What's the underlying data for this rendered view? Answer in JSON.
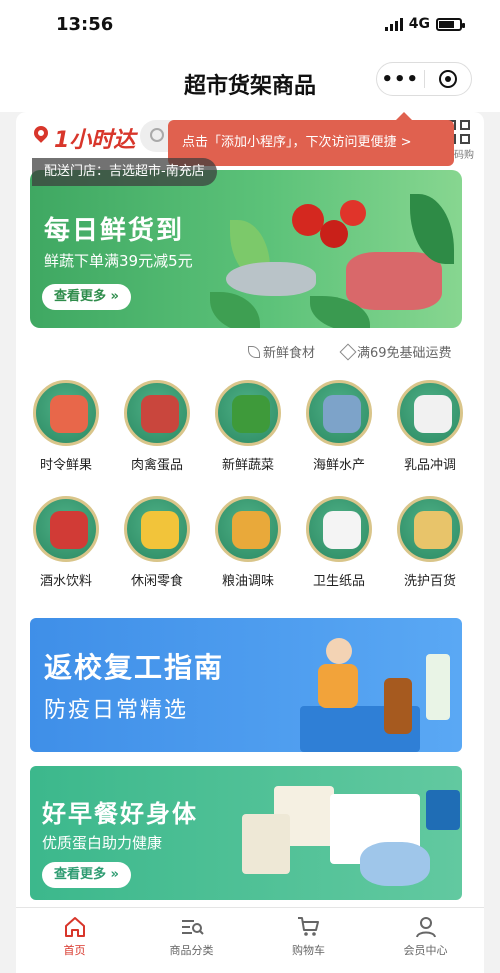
{
  "status_bar": {
    "time": "13:56",
    "network": "4G"
  },
  "navbar": {
    "title": "超市货架商品",
    "more_glyph": "•••"
  },
  "header": {
    "brand": "1小时达",
    "scan_label": "扫码购",
    "tooltip": "点击「添加小程序」，下次访问更便捷 >",
    "store": "配送门店：吉选超市-南充店"
  },
  "banner_fresh": {
    "title": "每日鲜货到",
    "subtitle": "鲜蔬下单满39元减5元",
    "button": "查看更多 »"
  },
  "tags": {
    "fresh": "新鲜食材",
    "shipping": "满69免基础运费"
  },
  "categories": [
    {
      "label": "时令鲜果",
      "color": "#e8674a"
    },
    {
      "label": "肉禽蛋品",
      "color": "#c9463d"
    },
    {
      "label": "新鲜蔬菜",
      "color": "#3e9a3a"
    },
    {
      "label": "海鲜水产",
      "color": "#7da3c9"
    },
    {
      "label": "乳品冲调",
      "color": "#f1f1f1"
    },
    {
      "label": "酒水饮料",
      "color": "#d13b36"
    },
    {
      "label": "休闲零食",
      "color": "#f2c43a"
    },
    {
      "label": "粮油调味",
      "color": "#e9a93a"
    },
    {
      "label": "卫生纸品",
      "color": "#f4f4f4"
    },
    {
      "label": "洗护百货",
      "color": "#e8c46a"
    }
  ],
  "banner_school": {
    "title": "返校复工指南",
    "subtitle": "防疫日常精选"
  },
  "banner_breakfast": {
    "title": "好早餐好身体",
    "subtitle": "优质蛋白助力健康",
    "button": "查看更多 »"
  },
  "tabbar": [
    {
      "label": "首页",
      "active": true
    },
    {
      "label": "商品分类",
      "active": false
    },
    {
      "label": "购物车",
      "active": false
    },
    {
      "label": "会员中心",
      "active": false
    }
  ]
}
